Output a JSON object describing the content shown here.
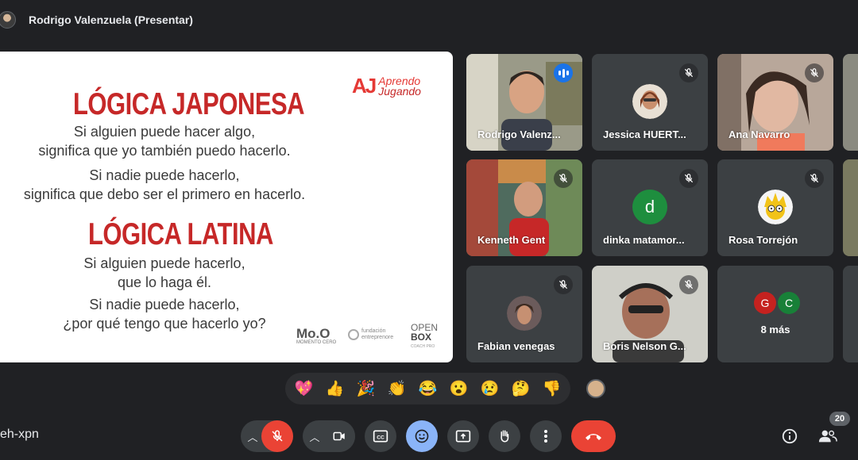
{
  "header": {
    "presenter_label": "Rodrigo Valenzuela (Presentar)"
  },
  "slide": {
    "heading_1": "LÓGICA JAPONESA",
    "para_1": [
      "Si alguien puede hacer algo,",
      "significa que yo también puedo hacerlo."
    ],
    "para_2": [
      "Si nadie puede hacerlo,",
      "significa que debo ser el primero en hacerlo."
    ],
    "heading_2": "LÓGICA LATINA",
    "para_3": [
      "Si alguien puede hacerlo,",
      "que lo haga él."
    ],
    "para_4": [
      "Si nadie puede hacerlo,",
      "¿por qué tengo que hacerlo yo?"
    ],
    "logo_mark": "AJ",
    "logo_word_1": "Aprendo",
    "logo_word_2": "Jugando",
    "sponsor_1": "Mo.O",
    "sponsor_1_sub": "MOMENTO CERO",
    "sponsor_2_a": "fundación",
    "sponsor_2_b": "entreprenore",
    "sponsor_3_a": "OPEN",
    "sponsor_3_b": "BOX",
    "sponsor_3_c": "COACH PRO"
  },
  "participants": [
    {
      "name": "Rodrigo Valenz...",
      "state": "speaking"
    },
    {
      "name": "Jessica HUERT...",
      "state": "muted"
    },
    {
      "name": "Ana Navarro",
      "state": "muted"
    },
    {
      "name": "Kenneth Gent",
      "state": "muted"
    },
    {
      "name": "dinka matamor...",
      "state": "muted",
      "initial": "d"
    },
    {
      "name": "Rosa Torrejón",
      "state": "muted"
    },
    {
      "name": "Fabian venegas",
      "state": "muted"
    },
    {
      "name": "Boris Nelson G...",
      "state": "muted"
    }
  ],
  "more_tile": {
    "initials": [
      "G",
      "C"
    ],
    "label": "8 más"
  },
  "colors": {
    "accent_blue": "#8ab4f8",
    "speaking_blue": "#1a73e8",
    "danger_red": "#ea4335",
    "slide_heading_red": "#c62828"
  },
  "reactions": [
    "💖",
    "👍",
    "🎉",
    "👏",
    "😂",
    "😮",
    "😢",
    "🤔",
    "👎"
  ],
  "bottom_bar": {
    "meeting_code": "eh-xpn",
    "participant_count": "20"
  },
  "icons": {
    "mic": "mic-off-icon",
    "camera": "videocam-icon",
    "captions": "cc-icon",
    "emoji": "emoji-icon",
    "present": "present-icon",
    "hand": "raise-hand-icon",
    "more": "more-vert-icon",
    "leave": "call-end-icon",
    "info": "info-icon",
    "people": "people-icon"
  }
}
